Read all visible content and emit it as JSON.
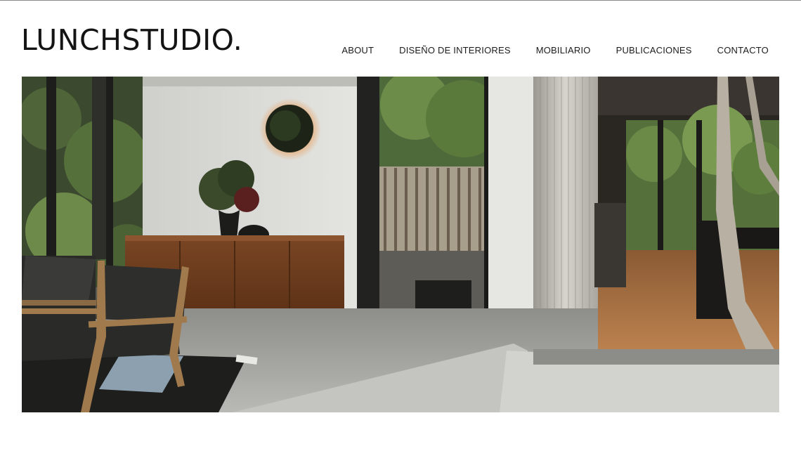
{
  "header": {
    "logo_text": "LUNCHSTUDIO."
  },
  "nav": {
    "items": [
      {
        "label": "ABOUT",
        "name": "nav-about"
      },
      {
        "label": "DISEÑO DE INTERIORES",
        "name": "nav-diseno-de-interiores"
      },
      {
        "label": "MOBILIARIO",
        "name": "nav-mobiliario"
      },
      {
        "label": "PUBLICACIONES",
        "name": "nav-publicaciones"
      },
      {
        "label": "CONTACTO",
        "name": "nav-contacto"
      }
    ]
  },
  "hero": {
    "image_subject": "interior-photo"
  },
  "colors": {
    "text": "#141414",
    "background": "#ffffff",
    "divider": "#8a8a8a"
  }
}
